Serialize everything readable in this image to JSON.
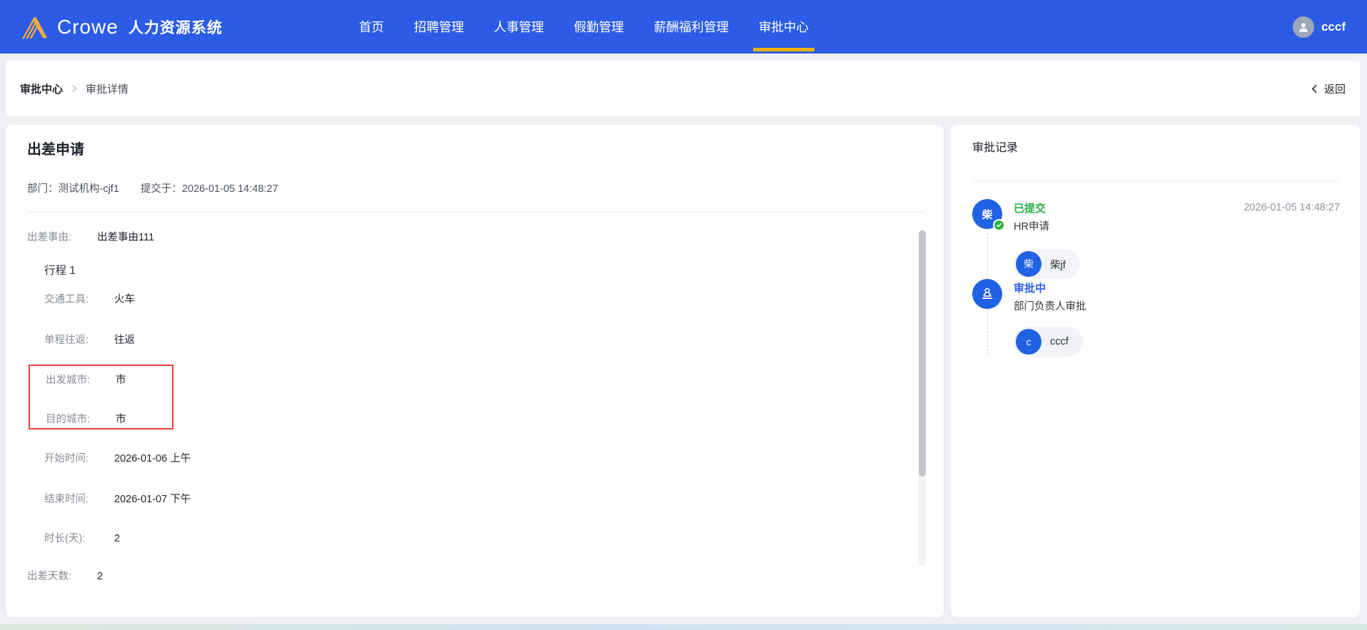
{
  "header": {
    "brand": {
      "name": "Crowe",
      "product": "人力资源系统"
    },
    "nav": [
      {
        "label": "首页",
        "active": false
      },
      {
        "label": "招聘管理",
        "active": false
      },
      {
        "label": "人事管理",
        "active": false
      },
      {
        "label": "假勤管理",
        "active": false
      },
      {
        "label": "薪酬福利管理",
        "active": false
      },
      {
        "label": "审批中心",
        "active": true
      }
    ],
    "user": {
      "name": "cccf"
    }
  },
  "breadcrumb": {
    "current_section": "审批中心",
    "page": "审批详情",
    "back_label": "返回"
  },
  "detail": {
    "title": "出差申请",
    "meta": {
      "department_label": "部门：",
      "department": "测试机构-cjf1",
      "submitted_label": "提交于：",
      "submitted_time": "2026-01-05 14:48:27"
    },
    "reason": {
      "label": "出差事由:",
      "value": "出差事由111"
    },
    "trip_title": "行程 1",
    "rows": [
      {
        "label": "交通工具:",
        "value": "火车"
      },
      {
        "label": "单程往返:",
        "value": "往返"
      },
      {
        "label": "出发城市:",
        "value": "市"
      },
      {
        "label": "目的城市:",
        "value": "市"
      },
      {
        "label": "开始时间:",
        "value": "2026-01-06 上午"
      },
      {
        "label": "结束时间:",
        "value": "2026-01-07 下午"
      },
      {
        "label": "时长(天):",
        "value": "2"
      }
    ],
    "days_row": {
      "label": "出差天数:",
      "value": "2"
    }
  },
  "approval": {
    "title": "审批记录",
    "steps": [
      {
        "status": "已提交",
        "desc": "HR申请",
        "time": "2026-01-05 14:48:27",
        "avatar_text": "柴",
        "person_avatar": "柴",
        "person_name": "柴jf"
      },
      {
        "status": "审批中",
        "desc": "部门负责人审批",
        "person_avatar": "c",
        "person_name": "cccf"
      }
    ]
  },
  "colors": {
    "header_blue": "#2c5ce5",
    "accent_blue": "#2161e3",
    "active_tab_underline": "#f2b600",
    "success_green": "#2aae43",
    "highlight_red": "#f23c3c",
    "logo_gold": "#efa93f"
  }
}
